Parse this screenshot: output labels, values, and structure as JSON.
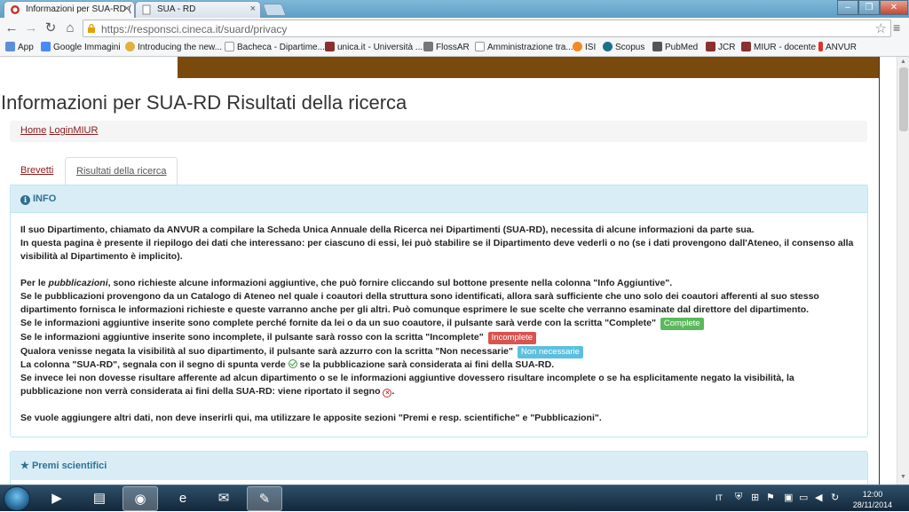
{
  "browser": {
    "tabs": [
      {
        "title": "Informazioni per SUA-RD (",
        "active": true
      },
      {
        "title": "SUA - RD",
        "active": false
      }
    ],
    "url": "https://responsci.cineca.it/suard/privacy",
    "bookmarks": [
      "App",
      "Google Immagini",
      "Introducing the new...",
      "Bacheca - Dipartime...",
      "unica.it - Università ...",
      "FlossAR",
      "Amministrazione tra...",
      "ISI",
      "Scopus",
      "PubMed",
      "JCR",
      "MIUR - docente",
      "ANVUR"
    ]
  },
  "page": {
    "title": "Informazioni per SUA-RD Risultati della ricerca",
    "breadcrumb": [
      "Home",
      "LoginMIUR"
    ],
    "tabs": [
      "Brevetti",
      "Risultati della ricerca"
    ],
    "info": {
      "heading": "INFO",
      "p1a": "Il suo Dipartimento, chiamato da ANVUR a compilare la Scheda Unica Annuale della Ricerca nei Dipartimenti (SUA-RD), necessita di alcune informazioni da parte sua.",
      "p1b": "In questa pagina è presente il riepilogo dei dati che interessano: per ciascuno di essi, lei può stabilire se il Dipartimento deve vederli o no (se i dati provengono dall'Ateneo, il consenso alla visibilità al Dipartimento è implicito).",
      "p2_pre": "Per le ",
      "p2_em": "pubblicazioni",
      "p2_post": ", sono richieste alcune informazioni aggiuntive, che può fornire cliccando sul bottone presente nella colonna \"Info Aggiuntive\".",
      "p3": "Se le pubblicazioni provengono da un Catalogo di Ateneo nel quale i coautori della struttura sono identificati, allora sarà sufficiente che uno solo dei coautori afferenti al suo stesso dipartimento fornisca le informazioni richieste e queste varranno anche per gli altri. Può comunque esprimere le sue scelte che verranno esaminate dal direttore del dipartimento.",
      "p4": "Se le informazioni aggiuntive inserite sono complete perché fornite da lei o da un suo coautore, il pulsante sarà verde con la scritta \"Complete\"",
      "p4_label": "Complete",
      "p5": "Se le informazioni aggiuntive inserite sono incomplete, il pulsante sarà rosso con la scritta \"Incomplete\"",
      "p5_label": "Incomplete",
      "p6": "Qualora venisse negata la visibilità al suo dipartimento, il pulsante sarà azzurro con la scritta \"Non necessarie\"",
      "p6_label": "Non necessarie",
      "p7a": "La colonna \"SUA-RD\", segnala con il segno di spunta verde",
      "p7b": "se la pubblicazione sarà considerata ai fini della SUA-RD.",
      "p8": "Se invece lei non dovesse risultare afferente ad alcun dipartimento o se le informazioni aggiuntive dovessero risultare incomplete o se ha esplicitamente negato la visibilità, la pubblicazione non verrà considerata ai fini della SUA-RD: viene riportato il segno",
      "p9": "Se vuole aggiungere altri dati, non deve inserirli qui, ma utilizzare le apposite sezioni \"Premi e resp. scientifiche\" e \"Pubblicazioni\"."
    },
    "premi_heading": "Premi scientifici"
  },
  "taskbar": {
    "lang": "IT",
    "time": "12:00",
    "date": "28/11/2014"
  },
  "colors": {
    "brown_bar": "#7a4a0d",
    "link": "#8b1a1a",
    "info_bg": "#d9edf7",
    "info_text": "#31708f"
  }
}
